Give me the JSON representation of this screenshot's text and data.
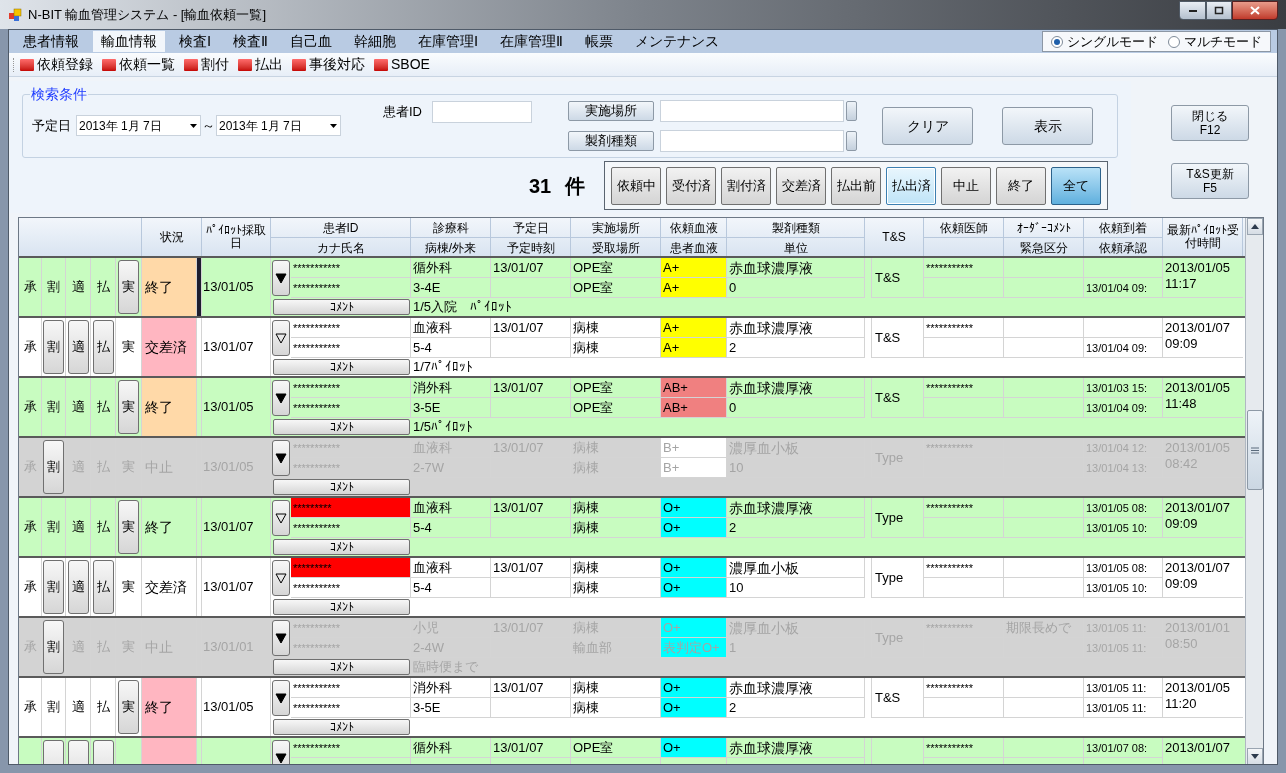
{
  "window": {
    "title": "N-BIT 輸血管理システム - [輸血依頼一覧]"
  },
  "menu": [
    {
      "label": "患者情報",
      "selected": false
    },
    {
      "label": "輸血情報",
      "selected": true
    },
    {
      "label": "検査Ⅰ",
      "selected": false
    },
    {
      "label": "検査Ⅱ",
      "selected": false
    },
    {
      "label": "自己血",
      "selected": false
    },
    {
      "label": "幹細胞",
      "selected": false
    },
    {
      "label": "在庫管理Ⅰ",
      "selected": false
    },
    {
      "label": "在庫管理Ⅱ",
      "selected": false
    },
    {
      "label": "帳票",
      "selected": false
    },
    {
      "label": "メンテナンス",
      "selected": false
    }
  ],
  "mode_options": [
    {
      "label": "シングルモード",
      "selected": true
    },
    {
      "label": "マルチモード",
      "selected": false
    }
  ],
  "toolbar": [
    "依頼登録",
    "依頼一覧",
    "割付",
    "払出",
    "事後対応",
    "SBOE"
  ],
  "search": {
    "legend": "検索条件",
    "date_label": "予定日",
    "date_from": "2013年 1月 7日",
    "separator": "～",
    "date_to": "2013年 1月 7日",
    "patient_id_label": "患者ID",
    "location_button": "実施場所",
    "product_button": "製剤種類",
    "clear_button": "クリア",
    "show_button": "表示"
  },
  "count": {
    "value": "31",
    "unit": "件"
  },
  "filters": [
    {
      "label": "依頼中",
      "selected": false,
      "focused": false
    },
    {
      "label": "受付済",
      "selected": false,
      "focused": false
    },
    {
      "label": "割付済",
      "selected": false,
      "focused": false
    },
    {
      "label": "交差済",
      "selected": false,
      "focused": false
    },
    {
      "label": "払出前",
      "selected": false,
      "focused": false
    },
    {
      "label": "払出済",
      "selected": false,
      "focused": true
    },
    {
      "label": "中止",
      "selected": false,
      "focused": false
    },
    {
      "label": "終了",
      "selected": false,
      "focused": false
    },
    {
      "label": "全て",
      "selected": true,
      "focused": false
    }
  ],
  "side_buttons": [
    {
      "line1": "閉じる",
      "line2": "F12"
    },
    {
      "line1": "T&S更新",
      "line2": "F5"
    }
  ],
  "table": {
    "columns": [
      {
        "top": "状況"
      },
      {
        "top": "ﾊﾟｲﾛｯﾄ採取日"
      },
      {
        "top": "患者ID",
        "bottom": "カナ氏名"
      },
      {
        "top": "診療科",
        "bottom": "病棟/外来"
      },
      {
        "top": "予定日",
        "bottom": "予定時刻"
      },
      {
        "top": "実施場所",
        "bottom": "受取場所"
      },
      {
        "top": "依頼血液",
        "bottom": "患者血液"
      },
      {
        "top": "製剤種類",
        "bottom": "単位"
      },
      {
        "top": "T&S"
      },
      {
        "top": "依頼医師"
      },
      {
        "top": "ｵｰﾀﾞｰｺﾒﾝﾄ",
        "bottom": "緊急区分"
      },
      {
        "top": "依頼到着",
        "bottom": "依頼承認"
      },
      {
        "top": "最新ﾊﾟｲﾛｯﾄ受付時間"
      }
    ],
    "rows": [
      {
        "color": "#c8fcc0",
        "disabled": false,
        "selected": true,
        "actions": [
          {
            "label": "承",
            "kind": "text"
          },
          {
            "label": "割",
            "kind": "text"
          },
          {
            "label": "適",
            "kind": "text"
          },
          {
            "label": "払",
            "kind": "text"
          },
          {
            "label": "実",
            "kind": "button"
          }
        ],
        "status": {
          "text": "終了",
          "color": "#ffd9a8"
        },
        "pilot_date": "13/01/05",
        "expander_filled": true,
        "patient_id": {
          "text": "***********"
        },
        "kana_name": "***********",
        "department": "循外科",
        "ward": "3-4E",
        "scheduled_date": "13/01/07",
        "location": "OPE室",
        "pickup_location": "OPE室",
        "requested_blood": {
          "text": "A+",
          "color": "#ffff00"
        },
        "patient_blood": {
          "text": "A+",
          "color": "#ffff00"
        },
        "product": "赤血球濃厚液",
        "units": "0",
        "ts": "T&S",
        "doctor": "***********",
        "approval": "13/01/04 09:",
        "latest_pilot": "2013/01/05 11:17",
        "comment_button": "ｺﾒﾝﾄ",
        "comment": "1/5入院　ﾊﾟｲﾛｯﾄ"
      },
      {
        "color": "#ffffff",
        "disabled": false,
        "selected": false,
        "actions": [
          {
            "label": "承",
            "kind": "text"
          },
          {
            "label": "割",
            "kind": "button"
          },
          {
            "label": "適",
            "kind": "button"
          },
          {
            "label": "払",
            "kind": "button"
          },
          {
            "label": "実",
            "kind": "text"
          }
        ],
        "status": {
          "text": "交差済",
          "color": "#ffb6c1"
        },
        "pilot_date": "13/01/07",
        "expander_filled": false,
        "patient_id": {
          "text": "***********"
        },
        "kana_name": "***********",
        "department": "血液科",
        "ward": "5-4",
        "scheduled_date": "13/01/07",
        "location": "病棟",
        "pickup_location": "病棟",
        "requested_blood": {
          "text": "A+",
          "color": "#ffff00"
        },
        "patient_blood": {
          "text": "A+",
          "color": "#ffff00"
        },
        "product": "赤血球濃厚液",
        "units": "2",
        "ts": "T&S",
        "doctor": "***********",
        "approval": "13/01/04 09:",
        "latest_pilot": "2013/01/07 09:09",
        "comment_button": "ｺﾒﾝﾄ",
        "comment": "1/7ﾊﾟｲﾛｯﾄ"
      },
      {
        "color": "#c8fcc0",
        "disabled": false,
        "selected": false,
        "actions": [
          {
            "label": "承",
            "kind": "text"
          },
          {
            "label": "割",
            "kind": "text"
          },
          {
            "label": "適",
            "kind": "text"
          },
          {
            "label": "払",
            "kind": "text"
          },
          {
            "label": "実",
            "kind": "button"
          }
        ],
        "status": {
          "text": "終了",
          "color": "#ffd9a8"
        },
        "pilot_date": "13/01/05",
        "expander_filled": true,
        "patient_id": {
          "text": "***********"
        },
        "kana_name": "***********",
        "department": "消外科",
        "ward": "3-5E",
        "scheduled_date": "13/01/07",
        "location": "OPE室",
        "pickup_location": "OPE室",
        "requested_blood": {
          "text": "AB+",
          "color": "#f08080"
        },
        "patient_blood": {
          "text": "AB+",
          "color": "#f08080"
        },
        "product": "赤血球濃厚液",
        "units": "0",
        "ts": "T&S",
        "doctor": "***********",
        "arrival": "13/01/03 15:",
        "approval": "13/01/04 09:",
        "latest_pilot": "2013/01/05 11:48",
        "comment_button": "ｺﾒﾝﾄ",
        "comment": "1/5ﾊﾟｲﾛｯﾄ"
      },
      {
        "color": "#d3d3d3",
        "disabled": true,
        "selected": false,
        "actions": [
          {
            "label": "承",
            "kind": "text"
          },
          {
            "label": "割",
            "kind": "button"
          },
          {
            "label": "適",
            "kind": "text"
          },
          {
            "label": "払",
            "kind": "text"
          },
          {
            "label": "実",
            "kind": "text"
          }
        ],
        "status": {
          "text": "中止"
        },
        "pilot_date": "13/01/05",
        "expander_filled": true,
        "patient_id": {
          "text": "***********"
        },
        "kana_name": "***********",
        "department": "血液科",
        "ward": "2-7W",
        "scheduled_date": "13/01/07",
        "location": "病棟",
        "pickup_location": "病棟",
        "requested_blood": {
          "text": "B+",
          "color": "#ffffff"
        },
        "patient_blood": {
          "text": "B+",
          "color": "#ffffff"
        },
        "product": "濃厚血小板",
        "units": "10",
        "ts": "Type",
        "doctor": "***********",
        "arrival": "13/01/04 12:",
        "approval": "13/01/04 13:",
        "latest_pilot": "2013/01/05 08:42",
        "comment_button": "ｺﾒﾝﾄ"
      },
      {
        "color": "#c8fcc0",
        "disabled": false,
        "selected": false,
        "actions": [
          {
            "label": "承",
            "kind": "text"
          },
          {
            "label": "割",
            "kind": "text"
          },
          {
            "label": "適",
            "kind": "text"
          },
          {
            "label": "払",
            "kind": "text"
          },
          {
            "label": "実",
            "kind": "button"
          }
        ],
        "status": {
          "text": "終了"
        },
        "pilot_date": "13/01/07",
        "expander_filled": false,
        "patient_id": {
          "text": "*********",
          "color": "#ff0000"
        },
        "kana_name": "***********",
        "department": "血液科",
        "ward": "5-4",
        "scheduled_date": "13/01/07",
        "location": "病棟",
        "pickup_location": "病棟",
        "requested_blood": {
          "text": "O+",
          "color": "#00ffff"
        },
        "patient_blood": {
          "text": "O+",
          "color": "#00ffff"
        },
        "product": "赤血球濃厚液",
        "units": "2",
        "ts": "Type",
        "doctor": "***********",
        "arrival": "13/01/05 08:",
        "approval": "13/01/05 10:",
        "latest_pilot": "2013/01/07 09:09",
        "comment_button": "ｺﾒﾝﾄ"
      },
      {
        "color": "#ffffff",
        "disabled": false,
        "selected": false,
        "actions": [
          {
            "label": "承",
            "kind": "text"
          },
          {
            "label": "割",
            "kind": "button"
          },
          {
            "label": "適",
            "kind": "button"
          },
          {
            "label": "払",
            "kind": "button"
          },
          {
            "label": "実",
            "kind": "text"
          }
        ],
        "status": {
          "text": "交差済"
        },
        "pilot_date": "13/01/07",
        "expander_filled": false,
        "patient_id": {
          "text": "*********",
          "color": "#ff0000"
        },
        "kana_name": "***********",
        "department": "血液科",
        "ward": "5-4",
        "scheduled_date": "13/01/07",
        "location": "病棟",
        "pickup_location": "病棟",
        "requested_blood": {
          "text": "O+",
          "color": "#00ffff"
        },
        "patient_blood": {
          "text": "O+",
          "color": "#00ffff"
        },
        "product": "濃厚血小板",
        "units": "10",
        "ts": "Type",
        "doctor": "***********",
        "arrival": "13/01/05 08:",
        "approval": "13/01/05 10:",
        "latest_pilot": "2013/01/07 09:09",
        "comment_button": "ｺﾒﾝﾄ"
      },
      {
        "color": "#d3d3d3",
        "disabled": true,
        "selected": false,
        "actions": [
          {
            "label": "承",
            "kind": "text"
          },
          {
            "label": "割",
            "kind": "button"
          },
          {
            "label": "適",
            "kind": "text"
          },
          {
            "label": "払",
            "kind": "text"
          },
          {
            "label": "実",
            "kind": "text"
          }
        ],
        "status": {
          "text": "中止"
        },
        "pilot_date": "13/01/01",
        "expander_filled": true,
        "patient_id": {
          "text": "***********"
        },
        "kana_name": "***********",
        "department": "小児",
        "ward": "2-4W",
        "scheduled_date": "13/01/07",
        "location": "病棟",
        "pickup_location": "輸血部",
        "requested_blood": {
          "text": "O+",
          "color": "#00ffff"
        },
        "patient_blood": {
          "text": "表判定O+",
          "color": "#00ffff"
        },
        "product": "濃厚血小板",
        "units": "1",
        "ts": "Type",
        "doctor": "***********",
        "order_comment": "期限長めで",
        "arrival": "13/01/05 11:",
        "approval": "13/01/05 11:",
        "latest_pilot": "2013/01/01 08:50",
        "comment_button": "ｺﾒﾝﾄ",
        "comment": "臨時便まで"
      },
      {
        "color": "#ffffff",
        "disabled": false,
        "selected": false,
        "actions": [
          {
            "label": "承",
            "kind": "text"
          },
          {
            "label": "割",
            "kind": "text"
          },
          {
            "label": "適",
            "kind": "text"
          },
          {
            "label": "払",
            "kind": "text"
          },
          {
            "label": "実",
            "kind": "button"
          }
        ],
        "status": {
          "text": "終了",
          "color": "#ffb6c1"
        },
        "pilot_date": "13/01/05",
        "expander_filled": true,
        "patient_id": {
          "text": "***********"
        },
        "kana_name": "***********",
        "department": "消外科",
        "ward": "3-5E",
        "scheduled_date": "13/01/07",
        "location": "病棟",
        "pickup_location": "病棟",
        "requested_blood": {
          "text": "O+",
          "color": "#00ffff"
        },
        "patient_blood": {
          "text": "O+",
          "color": "#00ffff"
        },
        "product": "赤血球濃厚液",
        "units": "2",
        "ts": "T&S",
        "doctor": "***********",
        "arrival": "13/01/05 11:",
        "approval": "13/01/05 11:",
        "latest_pilot": "2013/01/05 11:20",
        "comment_button": "ｺﾒﾝﾄ"
      },
      {
        "color": "#c8fcc0",
        "disabled": false,
        "selected": false,
        "actions": [
          {
            "kind": "text"
          },
          {
            "kind": "button"
          },
          {
            "kind": "button"
          },
          {
            "kind": "button"
          },
          {
            "kind": "text"
          }
        ],
        "status": {
          "color": "#ffb6c1"
        },
        "expander_filled": true,
        "patient_id": {
          "text": "***********"
        },
        "department": "循外科",
        "scheduled_date": "13/01/07",
        "location": "OPE室",
        "requested_blood": {
          "text": "O+",
          "color": "#00ffff"
        },
        "product": "赤血球濃厚液",
        "doctor": "***********",
        "arrival": "13/01/07 08:",
        "latest_pilot": "2013/01/07"
      }
    ]
  }
}
